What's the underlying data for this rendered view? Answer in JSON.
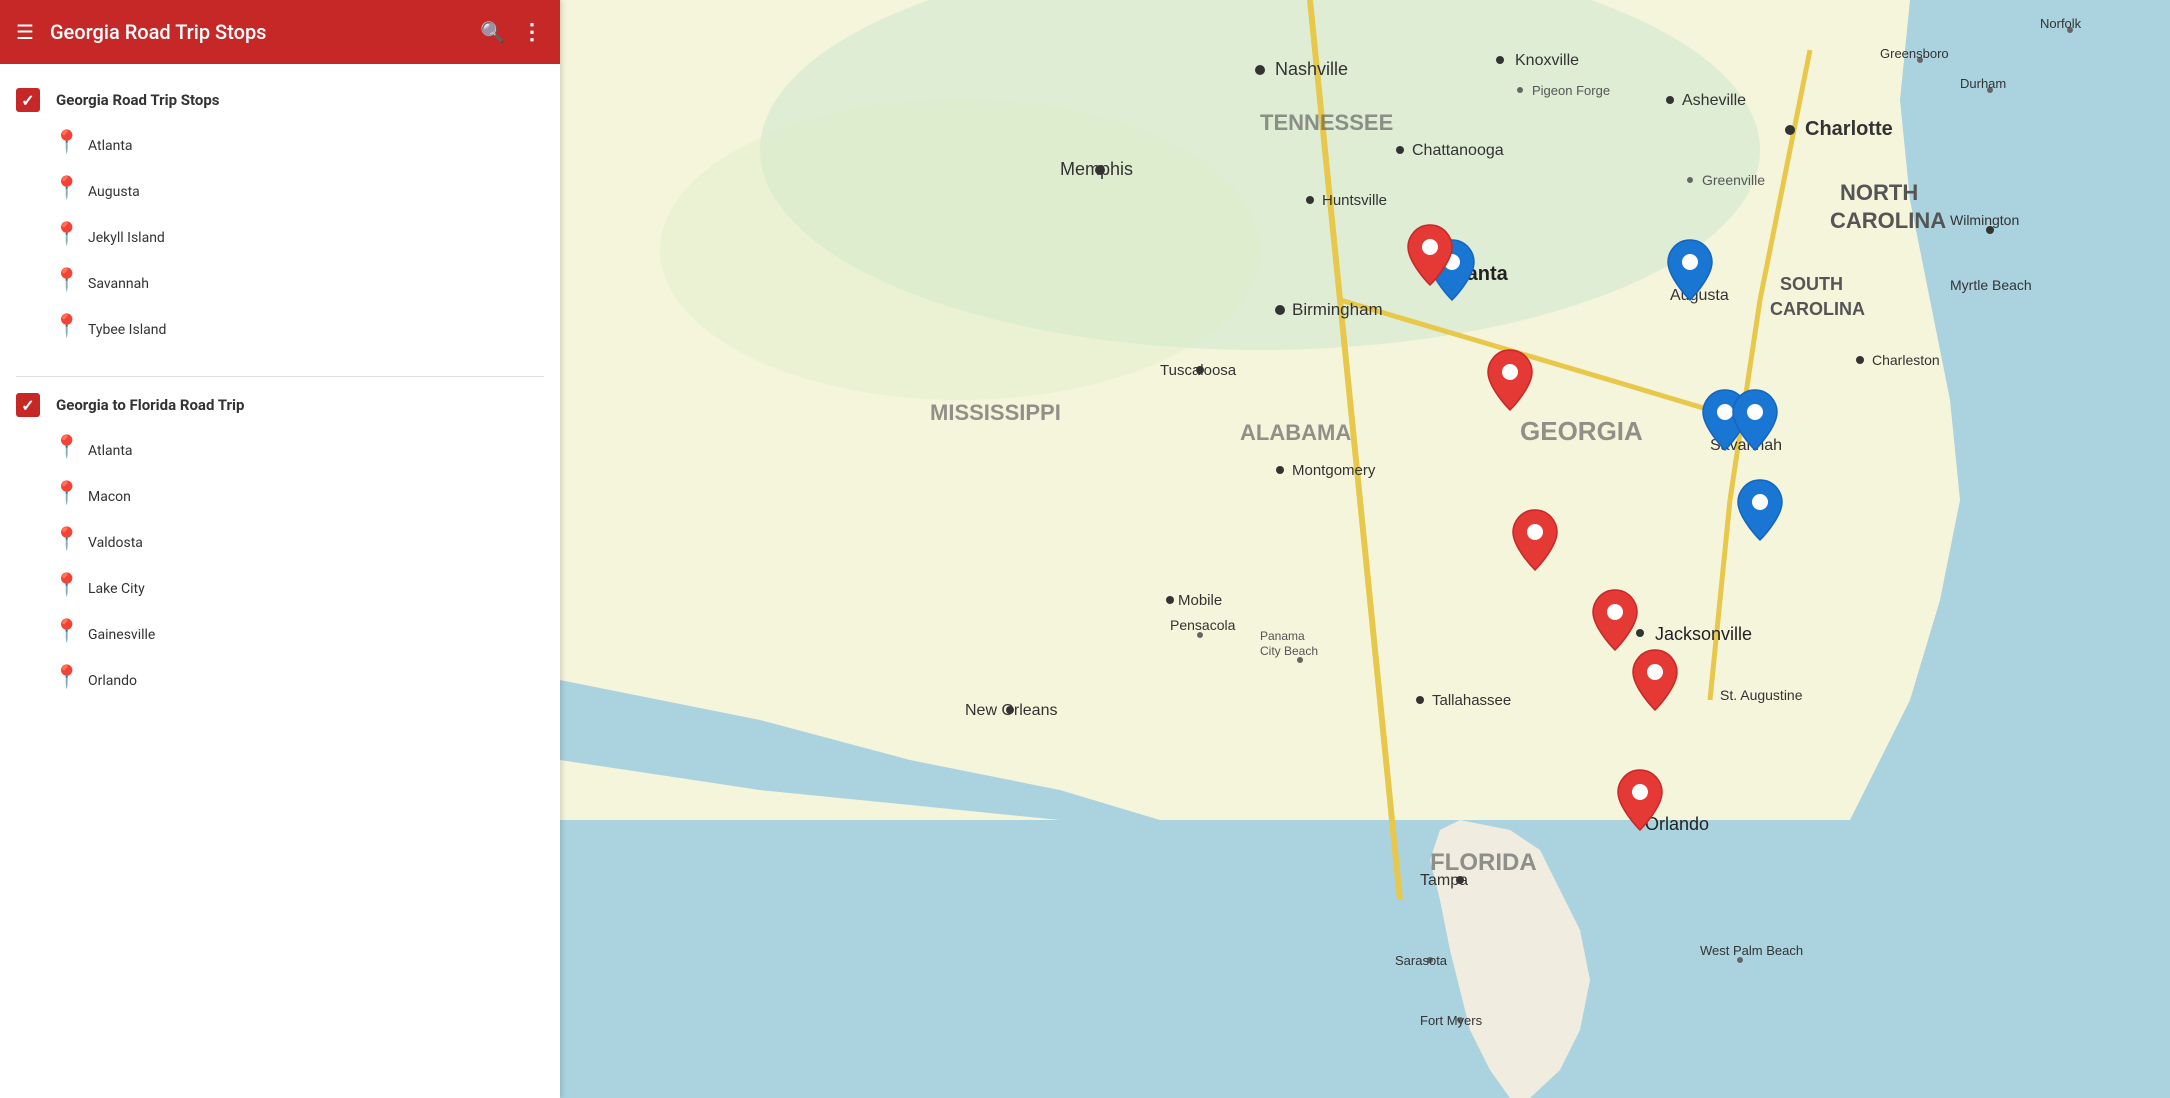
{
  "header": {
    "title": "Georgia Road Trip Stops",
    "menu_icon": "☰",
    "search_icon": "🔍",
    "more_icon": "⋮"
  },
  "sidebar": {
    "layer1": {
      "title": "Georgia Road Trip Stops",
      "pin_color": "blue",
      "locations": [
        {
          "name": "Atlanta"
        },
        {
          "name": "Augusta"
        },
        {
          "name": "Jekyll Island"
        },
        {
          "name": "Savannah"
        },
        {
          "name": "Tybee Island"
        }
      ]
    },
    "layer2": {
      "title": "Georgia to Florida Road Trip",
      "pin_color": "red",
      "locations": [
        {
          "name": "Atlanta"
        },
        {
          "name": "Macon"
        },
        {
          "name": "Valdosta"
        },
        {
          "name": "Lake City"
        },
        {
          "name": "Gainesville"
        },
        {
          "name": "Orlando"
        }
      ]
    }
  },
  "map": {
    "bg_color": "#aad3df",
    "markers": {
      "blue": [
        {
          "id": "atlanta-blue",
          "label": "Atlanta",
          "top": "27",
          "left": "32"
        },
        {
          "id": "augusta-blue",
          "label": "Augusta",
          "top": "27",
          "left": "43"
        },
        {
          "id": "jekyll-blue",
          "label": "Jekyll Island",
          "top": "46",
          "left": "52"
        },
        {
          "id": "savannah-blue1",
          "label": "Savannah",
          "top": "40",
          "left": "51"
        },
        {
          "id": "savannah-blue2",
          "label": "Savannah2",
          "top": "40",
          "left": "53"
        },
        {
          "id": "tybee-blue",
          "label": "Tybee Island",
          "top": "38",
          "left": "55"
        }
      ],
      "red": [
        {
          "id": "atlanta-red",
          "label": "Atlanta",
          "top": "24",
          "left": "33"
        },
        {
          "id": "macon-red",
          "label": "Macon",
          "top": "33",
          "left": "35"
        },
        {
          "id": "valdosta-red",
          "label": "Valdosta",
          "top": "48",
          "left": "37"
        },
        {
          "id": "jacksonville-red",
          "label": "Jacksonville",
          "top": "53",
          "left": "42"
        },
        {
          "id": "staugustine-red",
          "label": "St. Augustine",
          "top": "58",
          "left": "44"
        },
        {
          "id": "orlando-red",
          "label": "Orlando",
          "top": "68",
          "left": "43"
        }
      ]
    }
  }
}
